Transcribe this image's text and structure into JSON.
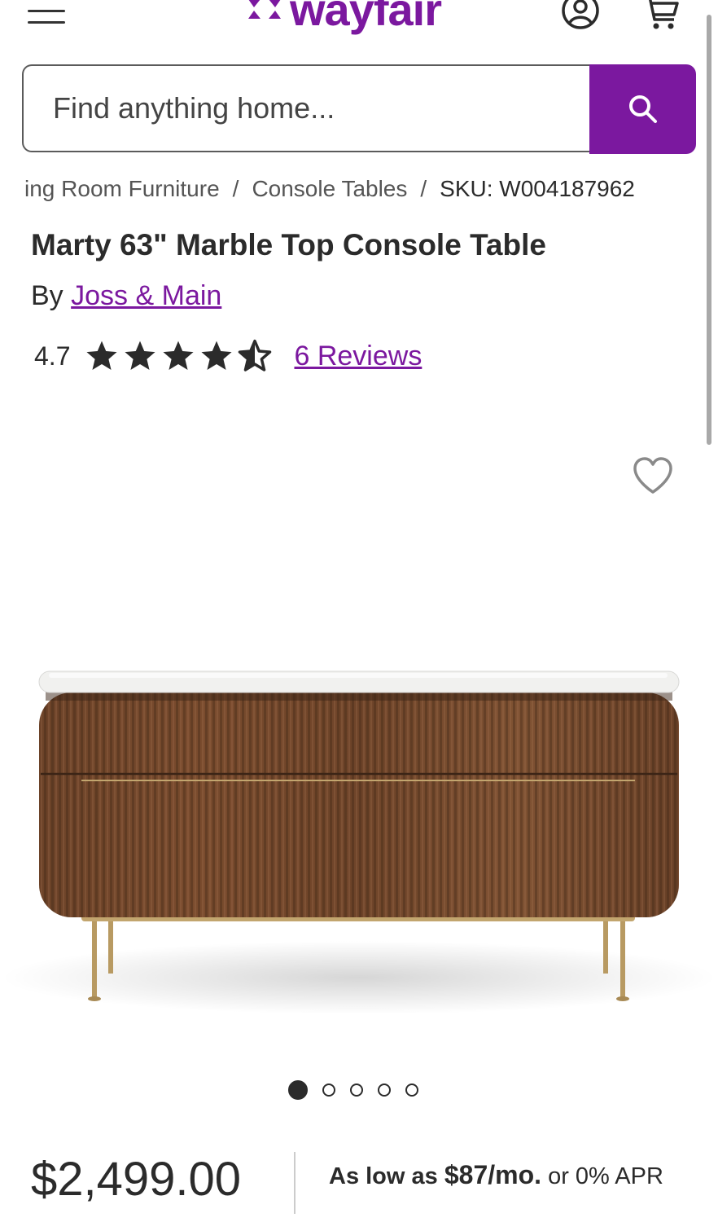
{
  "header": {
    "logo_text": "wayfair",
    "icons": [
      "menu-icon",
      "account-icon",
      "cart-icon"
    ],
    "brand_color": "#7b189f"
  },
  "search": {
    "placeholder": "Find anything home...",
    "button_icon": "search-icon"
  },
  "breadcrumb": {
    "items": [
      "ing Room Furniture",
      "Console Tables"
    ],
    "separator": "/",
    "sku": "SKU: W004187962"
  },
  "product": {
    "title": "Marty 63\" Marble Top Console Table",
    "by_label": "By",
    "brand": "Joss & Main",
    "rating": "4.7",
    "rating_value": 4.7,
    "reviews_label": "6 Reviews",
    "favorite_icon": "heart-icon"
  },
  "gallery": {
    "total_images": 5,
    "active_index": 0
  },
  "pricing": {
    "price": "$2,499.00",
    "financing_prefix": "As low as",
    "financing_amount": "$87/mo.",
    "financing_suffix": "or 0% APR"
  }
}
